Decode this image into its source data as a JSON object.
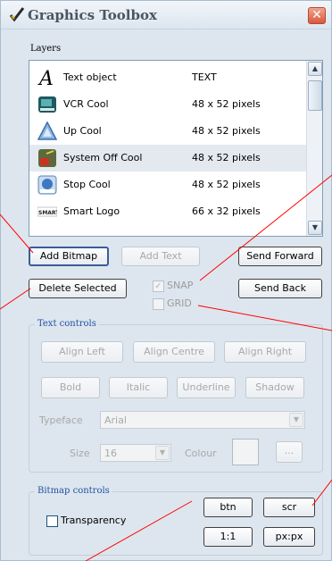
{
  "window": {
    "title": "Graphics Toolbox",
    "close_glyph": "✕"
  },
  "layers": {
    "label": "Layers",
    "items": [
      {
        "name": "Text object",
        "size": "TEXT",
        "icon": "text-letter-icon"
      },
      {
        "name": "VCR Cool",
        "size": "48 x 52 pixels",
        "icon": "video-icon"
      },
      {
        "name": "Up Cool",
        "size": "48 x 52 pixels",
        "icon": "up-arrow-icon"
      },
      {
        "name": "System Off Cool",
        "size": "48 x 52 pixels",
        "icon": "power-icon",
        "selected": true
      },
      {
        "name": "Stop Cool",
        "size": "48 x 52 pixels",
        "icon": "stop-icon"
      },
      {
        "name": "Smart Logo",
        "size": "66 x 32 pixels",
        "icon": "logo-icon",
        "icon_text": "SMART"
      }
    ]
  },
  "buttons": {
    "add_bitmap": "Add Bitmap",
    "add_text": "Add Text",
    "send_forward": "Send Forward",
    "delete_selected": "Delete Selected",
    "send_back": "Send Back"
  },
  "snap": {
    "label": "SNAP",
    "checked": true
  },
  "grid": {
    "label": "GRID",
    "checked": false
  },
  "text_controls": {
    "title": "Text controls",
    "align_left": "Align Left",
    "align_centre": "Align Centre",
    "align_right": "Align Right",
    "bold": "Bold",
    "italic": "Italic",
    "underline": "Underline",
    "shadow": "Shadow",
    "typeface_label": "Typeface",
    "typeface_value": "Arial",
    "size_label": "Size",
    "size_value": "16",
    "colour_label": "Colour",
    "colour_button": "..."
  },
  "bitmap_controls": {
    "title": "Bitmap controls",
    "transparency_label": "Transparency",
    "btn": "btn",
    "scr": "scr",
    "one_to_one": "1:1",
    "px_px": "px:px"
  },
  "colors": {
    "window_bg": "#dde6ee",
    "group_title": "#2150a5",
    "annotation_line": "#ff0000",
    "close_button": "#d9583e"
  }
}
